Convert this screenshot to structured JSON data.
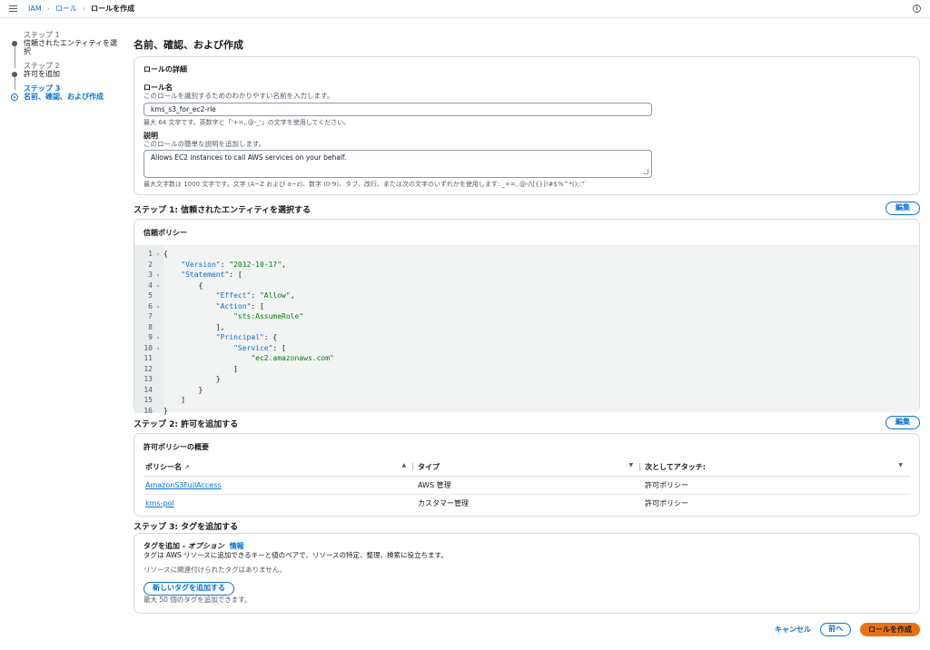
{
  "breadcrumb": [
    "IAM",
    "ロール",
    "ロールを作成"
  ],
  "steps": [
    {
      "num": "ステップ 1",
      "label": "信頼されたエンティティを選択"
    },
    {
      "num": "ステップ 2",
      "label": "許可を追加"
    },
    {
      "num": "ステップ 3",
      "label": "名前、確認、および作成"
    }
  ],
  "page_title": "名前、確認、および作成",
  "role_details": {
    "title": "ロールの詳細",
    "name_label": "ロール名",
    "name_desc": "このロールを識別するためのわかりやすい名前を入力します。",
    "name_value": "kms_s3_for_ec2-rle",
    "name_constraint": "最大 64 文字です。英数字と「'+=,.@-_'」の文字を使用してください。",
    "desc_label": "説明",
    "desc_desc": "このロールの簡単な説明を追加します。",
    "desc_value": "Allows EC2 instances to call AWS services on your behalf.",
    "desc_constraint": "最大文字数は 1000 文字です。文字 (A~Z および a~z)、数字 (0-9)、タブ、改行、または次の文字のいずれかを使用します: _+=,.@-/\\[{}]!#$%^*();:\"`"
  },
  "step1": {
    "title": "ステップ 1: 信頼されたエンティティを選択する",
    "edit": "編集",
    "panel_title": "信頼ポリシー",
    "code": [
      "{",
      "    \"Version\": \"2012-10-17\",",
      "    \"Statement\": [",
      "        {",
      "            \"Effect\": \"Allow\",",
      "            \"Action\": [",
      "                \"sts:AssumeRole\"",
      "            ],",
      "            \"Principal\": {",
      "                \"Service\": [",
      "                    \"ec2.amazonaws.com\"",
      "                ]",
      "            }",
      "        }",
      "    ]",
      "}"
    ]
  },
  "step2": {
    "title": "ステップ 2: 許可を追加する",
    "edit": "編集",
    "panel_title": "許可ポリシーの概要",
    "columns": [
      "ポリシー名",
      "タイプ",
      "次としてアタッチ:"
    ],
    "rows": [
      [
        "AmazonS3FullAccess",
        "AWS 管理",
        "許可ポリシー"
      ],
      [
        "kms-pol",
        "カスタマー管理",
        "許可ポリシー"
      ]
    ]
  },
  "step3": {
    "title": "ステップ 3: タグを追加する",
    "tag_title": "タグを追加 - ",
    "tag_optional": "オプション",
    "info": "情報",
    "tag_desc": "タグは AWS リソースに追加できるキーと値のペアで、リソースの特定、整理、検索に役立ちます。",
    "no_tags": "リソースに関連付けられたタグはありません。",
    "add_tag": "新しいタグを追加する",
    "limit": "最大 50 個のタグを追加できます。"
  },
  "footer": {
    "cancel": "キャンセル",
    "back": "前へ",
    "create": "ロールを作成"
  },
  "colors": {
    "link": "#0972d3",
    "primary": "#ec7211",
    "string": "#037f0c"
  }
}
